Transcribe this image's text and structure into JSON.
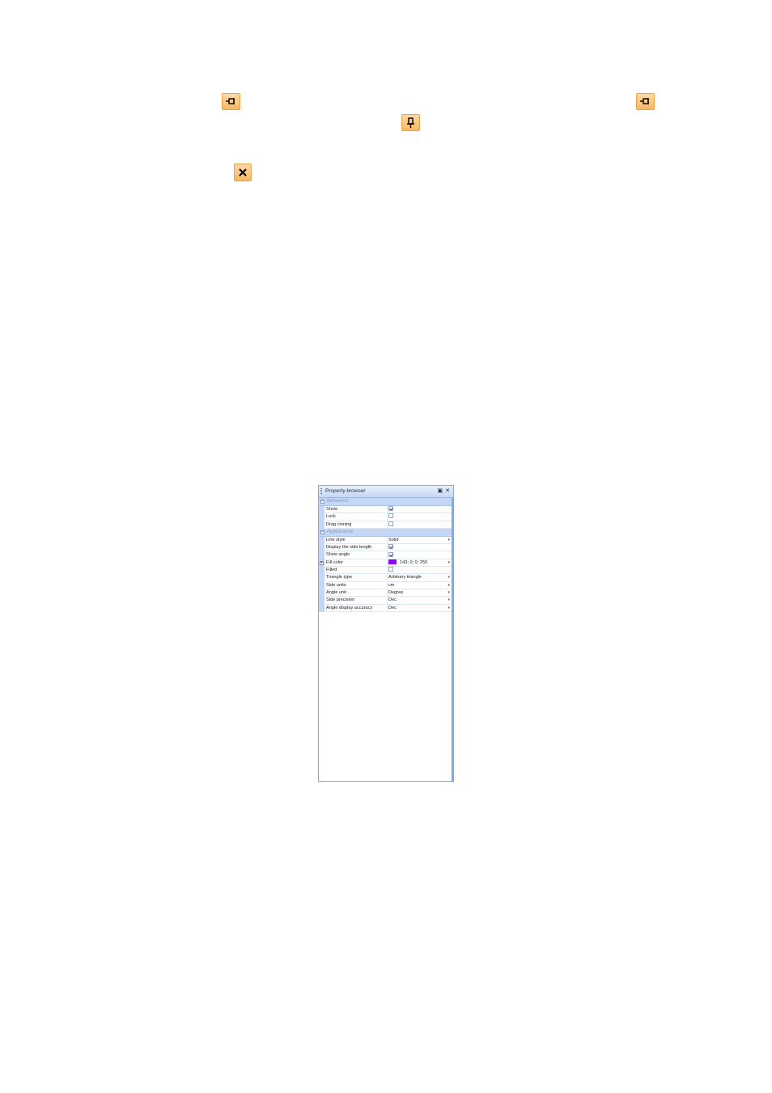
{
  "icons": {
    "pin_left_1": "pin-horizontal-icon",
    "pin_left_2": "pin-horizontal-icon",
    "pin_down": "pin-vertical-icon",
    "close": "close-icon"
  },
  "colors": {
    "icon_bg": "#f7b860",
    "category_bg": "#c5d7f5",
    "fill_color": "#8f00ff"
  },
  "panel": {
    "title": "Property browser",
    "categories": [
      {
        "label": "Behaviors",
        "rows": [
          {
            "name": "Show",
            "type": "check",
            "checked": true
          },
          {
            "name": "Lock",
            "type": "check",
            "checked": false
          },
          {
            "name": "Drag cloning",
            "type": "check",
            "checked": false
          }
        ]
      },
      {
        "label": "Appearance",
        "rows": [
          {
            "name": "Line style",
            "type": "select",
            "value": "Solid"
          },
          {
            "name": "Display the side length",
            "type": "check",
            "checked": true
          },
          {
            "name": "Show angle",
            "type": "check",
            "checked": true
          },
          {
            "name": "Fill color",
            "type": "color",
            "value": "143; 0; 0; 255"
          },
          {
            "name": "Filled",
            "type": "check",
            "checked": false
          },
          {
            "name": "Triangle type",
            "type": "select",
            "value": "Arbitrary triangle"
          },
          {
            "name": "Side units",
            "type": "select",
            "value": "cm"
          },
          {
            "name": "Angle unit",
            "type": "select",
            "value": "Degree"
          },
          {
            "name": "Side precision",
            "type": "select",
            "value": "Dec"
          },
          {
            "name": "Angle display accuracy",
            "type": "select",
            "value": "Dec"
          }
        ]
      }
    ]
  }
}
